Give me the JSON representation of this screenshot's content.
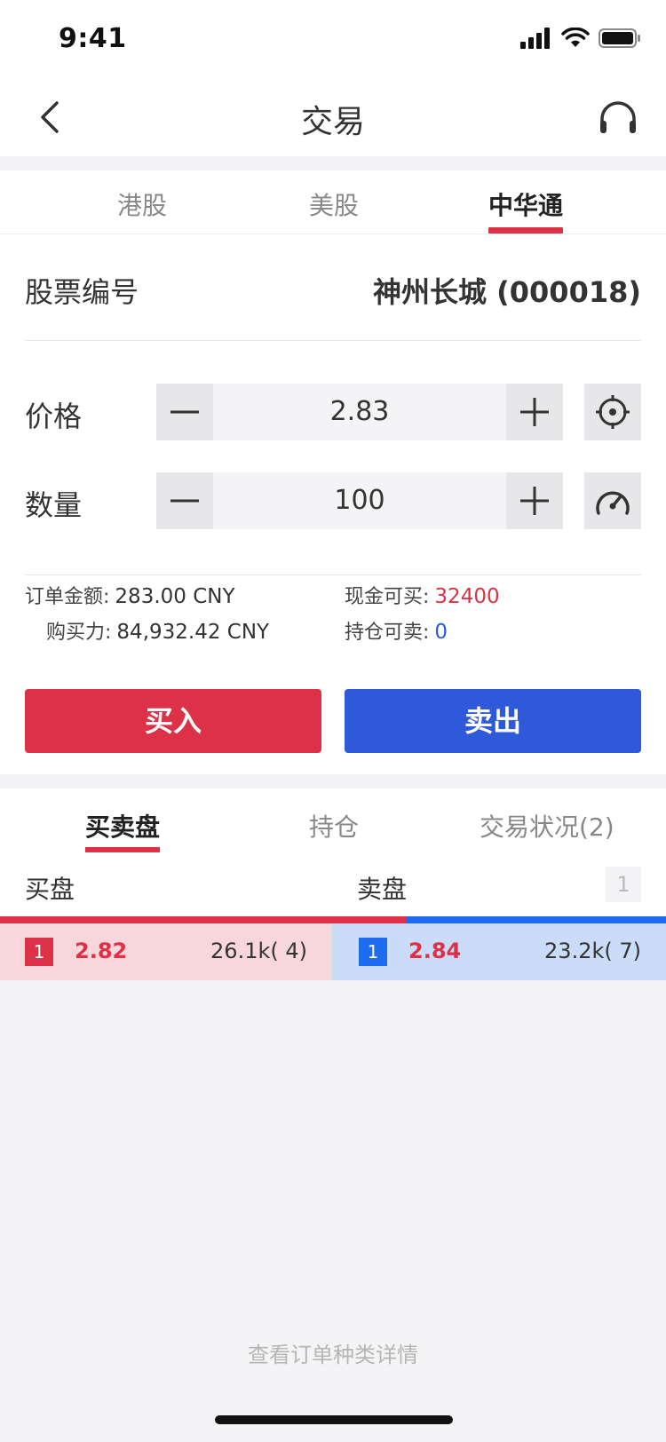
{
  "status": {
    "time": "9:41"
  },
  "nav": {
    "title": "交易"
  },
  "market_tabs": [
    "港股",
    "美股",
    "中华通"
  ],
  "stock": {
    "label": "股票编号",
    "value": "神州长城 (000018)"
  },
  "price": {
    "label": "价格",
    "value": "2.83"
  },
  "quantity": {
    "label": "数量",
    "value": "100"
  },
  "summary": {
    "order_amount_label": "订单金额:",
    "order_amount_value": "283.00  CNY",
    "buying_power_label": "购买力:",
    "buying_power_value": "84,932.42  CNY",
    "cash_buyable_label": "现金可买:",
    "cash_buyable_value": "32400",
    "position_sellable_label": "持仓可卖:",
    "position_sellable_value": "0"
  },
  "actions": {
    "buy": "买入",
    "sell": "卖出"
  },
  "book_tabs": [
    "买卖盘",
    "持仓",
    "交易状况(2)"
  ],
  "book": {
    "bid_header": "买盘",
    "ask_header": "卖盘",
    "level": "1",
    "bid": {
      "level": "1",
      "price": "2.82",
      "volume": "26.1k(    4)"
    },
    "ask": {
      "level": "1",
      "price": "2.84",
      "volume": "23.2k(    7)"
    }
  },
  "footer": {
    "link": "查看订单种类详情"
  },
  "colors": {
    "red": "#dc3146",
    "blue": "#2e59d9",
    "ask_blue": "#1f6bf0"
  }
}
